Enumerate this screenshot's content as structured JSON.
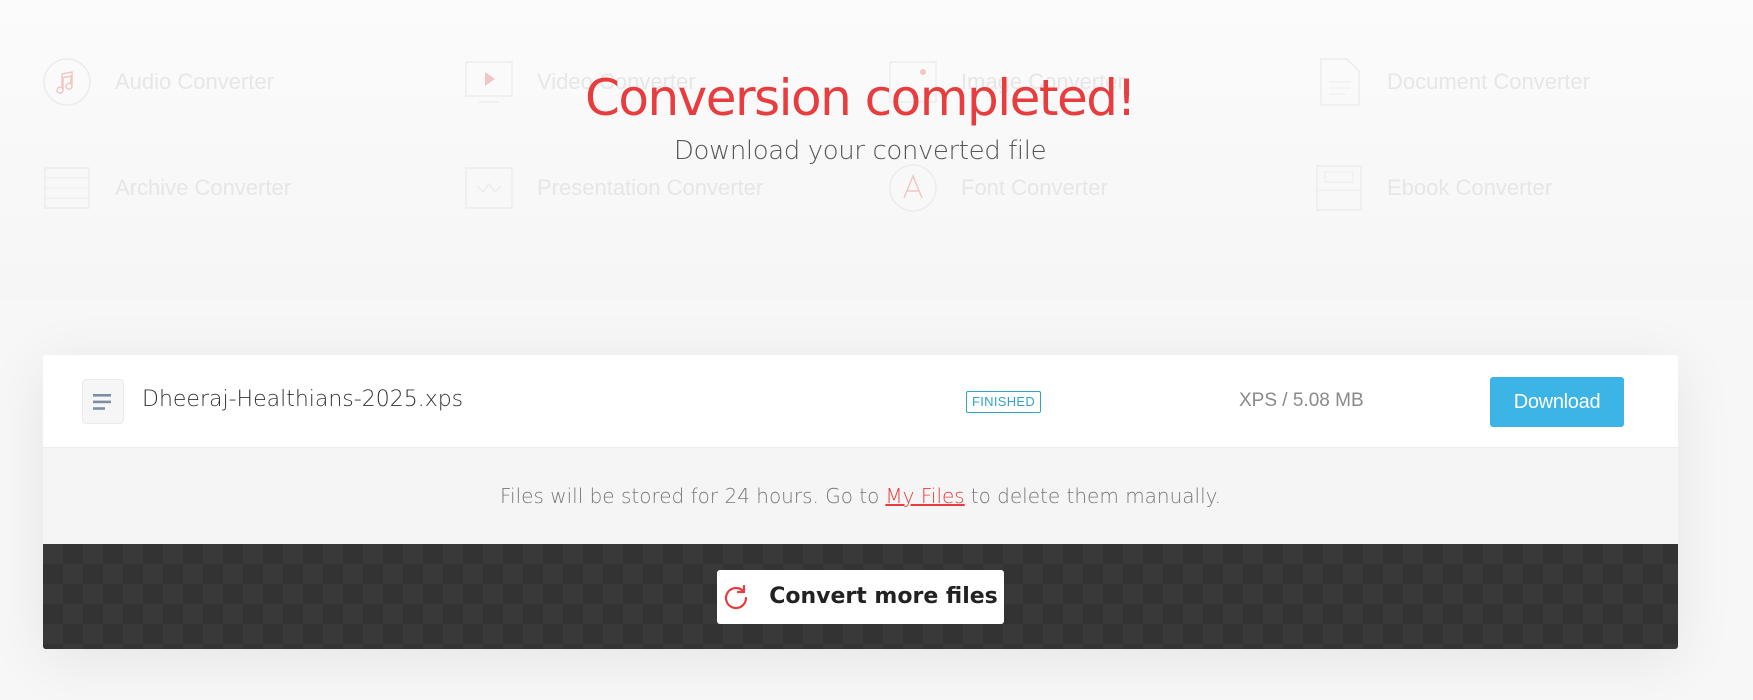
{
  "background_tiles": [
    {
      "label": "Audio Converter",
      "icon": "music-note-icon"
    },
    {
      "label": "Video Converter",
      "icon": "video-play-icon"
    },
    {
      "label": "Image Converter",
      "icon": "image-icon"
    },
    {
      "label": "Document Converter",
      "icon": "document-icon"
    },
    {
      "label": "Archive Converter",
      "icon": "archive-icon"
    },
    {
      "label": "Presentation Converter",
      "icon": "presentation-icon"
    },
    {
      "label": "Font Converter",
      "icon": "font-icon"
    },
    {
      "label": "Ebook Converter",
      "icon": "ebook-icon"
    }
  ],
  "hero": {
    "title": "Conversion completed!",
    "subtitle": "Download your converted file"
  },
  "file": {
    "name": "Dheeraj-Healthians-2025.xps",
    "status": "FINISHED",
    "meta": "XPS / 5.08 MB",
    "download_label": "Download"
  },
  "notice": {
    "before": "Files will be stored for 24 hours. Go to",
    "link": "My Files",
    "after": "to delete them manually."
  },
  "actions": {
    "convert_more_label": "Convert more files"
  },
  "colors": {
    "accent_red": "#e83d3f",
    "download_blue": "#3cb4e5",
    "status_teal": "#30a4c9"
  }
}
